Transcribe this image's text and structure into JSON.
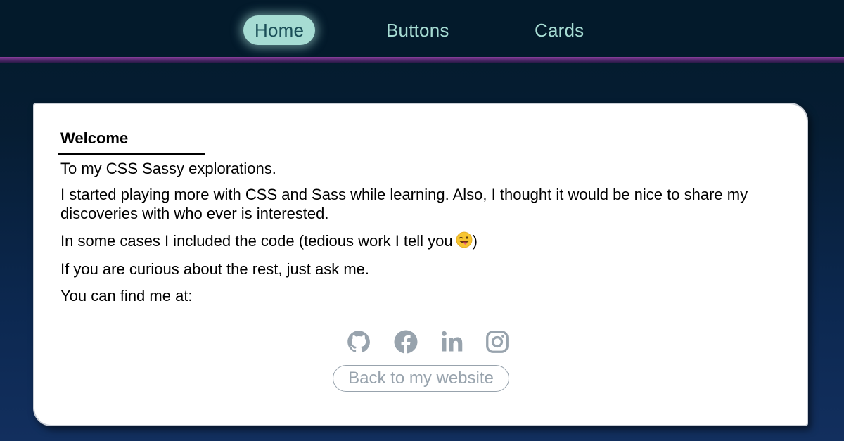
{
  "nav": {
    "items": [
      {
        "label": "Home",
        "active": true
      },
      {
        "label": "Buttons",
        "active": false
      },
      {
        "label": "Cards",
        "active": false
      }
    ]
  },
  "card": {
    "title": "Welcome",
    "paragraphs": [
      "To my CSS Sassy explorations.",
      "I started playing more with CSS and Sass while learning. Also, I thought it would be nice to share my discoveries with who ever is interested.",
      "In some cases I included the code (tedious work I tell you",
      "If you are curious about the rest, just ask me.",
      "You can find me at:"
    ],
    "paragraph3_suffix": ")",
    "emoji": "winking-face-with-tongue",
    "social_icons": [
      "github-icon",
      "facebook-icon",
      "linkedin-icon",
      "instagram-icon"
    ],
    "back_button": "Back to my website"
  },
  "colors": {
    "nav_accent": "#a6dcd3",
    "icon_gray": "#98a3ad",
    "divider_purple": "#8a3f9a"
  }
}
